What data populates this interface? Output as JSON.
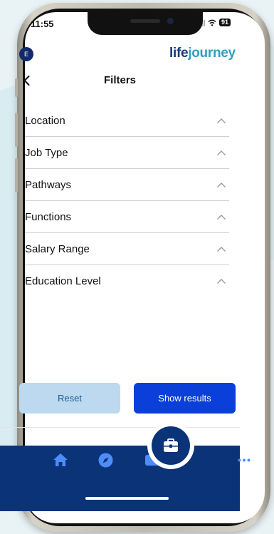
{
  "status_bar": {
    "time": "11:55",
    "battery": "91"
  },
  "header": {
    "avatar_initial": "E",
    "logo_part1": "life",
    "logo_part2": "journey"
  },
  "nav": {
    "title": "Filters"
  },
  "filters": [
    {
      "label": "Location"
    },
    {
      "label": "Job Type"
    },
    {
      "label": "Pathways"
    },
    {
      "label": "Functions"
    },
    {
      "label": "Salary Range"
    },
    {
      "label": "Education Level"
    }
  ],
  "actions": {
    "reset_label": "Reset",
    "show_results_label": "Show results"
  },
  "tabbar": {
    "items": [
      {
        "icon": "home-icon"
      },
      {
        "icon": "compass-icon"
      },
      {
        "icon": "wallet-icon"
      },
      {
        "icon": "briefcase-icon",
        "active": true
      },
      {
        "icon": "more-icon"
      }
    ]
  },
  "colors": {
    "brand_navy": "#0b3377",
    "logo_dark": "#1a3a78",
    "logo_teal": "#2fa0bf",
    "primary_button": "#0a3fd9",
    "secondary_button": "#bcd9ef"
  }
}
